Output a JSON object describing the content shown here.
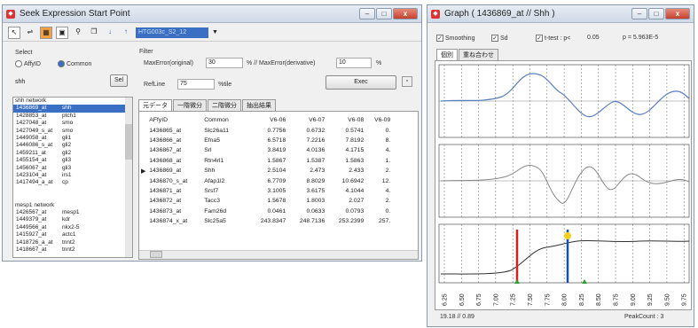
{
  "win1": {
    "title": "Seek Expression Start Point",
    "min": "–",
    "max": "□",
    "close": "x",
    "toolbar_combo": "HTG003c_S2_12"
  },
  "select": {
    "label": "Select",
    "opt_affy": "AffyID",
    "opt_common": "Common",
    "search_value": "shh",
    "sel_button": "Sel"
  },
  "filter": {
    "label": "Filter",
    "maxerror_label": "MaxError(original)",
    "maxerror_value": "30",
    "maxerror_deriv_label": "% // MaxError(derivative)",
    "maxerror_deriv_value": "10",
    "pct": "%",
    "refline_label": "RefLine",
    "refline_value": "75",
    "tile": "%tile",
    "exec": "Exec"
  },
  "list1": {
    "header": "shh network",
    "items": [
      [
        "1436869_at",
        "shh"
      ],
      [
        "1428853_at",
        "ptch1"
      ],
      [
        "1427048_at",
        "smo"
      ],
      [
        "1427049_s_at",
        "smo"
      ],
      [
        "1449058_at",
        "gli1"
      ],
      [
        "1446086_s_at",
        "gli2"
      ],
      [
        "1459211_at",
        "gli2"
      ],
      [
        "1455154_at",
        "gli3"
      ],
      [
        "1456067_at",
        "gli3"
      ],
      [
        "1423104_at",
        "irs1"
      ],
      [
        "1417494_a_at",
        "cp"
      ]
    ]
  },
  "list2": {
    "header": "mesp1 network",
    "items": [
      [
        "1426567_at",
        "mesp1"
      ],
      [
        "1449379_at",
        "kdr"
      ],
      [
        "1449566_at",
        "nkx2-5"
      ],
      [
        "1415927_at",
        "actc1"
      ],
      [
        "1418726_a_at",
        "tnnt2"
      ],
      [
        "1418667_at",
        "tnnt2"
      ]
    ]
  },
  "tabs1": [
    "元データ",
    "一階微分",
    "二階微分",
    "抽出結果"
  ],
  "table": {
    "columns": [
      "AFfyID",
      "Common",
      "V6-06",
      "V6-07",
      "V6-08",
      "V6-09"
    ],
    "rows": [
      [
        "1436865_at",
        "Slc26a11",
        "0.7756",
        "0.6732",
        "0.5741",
        "0."
      ],
      [
        "1436866_at",
        "Efna5",
        "6.5718",
        "7.2216",
        "7.8192",
        "8."
      ],
      [
        "1436867_at",
        "Srl",
        "3.8419",
        "4.0136",
        "4.1715",
        "4."
      ],
      [
        "1436868_at",
        "Rtn4rl1",
        "1.5867",
        "1.5387",
        "1.5863",
        "1."
      ],
      [
        "1436869_at",
        "Shh",
        "2.5104",
        "2.473",
        "2.433",
        "2."
      ],
      [
        "1436870_s_at",
        "Afap1l2",
        "6.7709",
        "8.8029",
        "10.6942",
        "12."
      ],
      [
        "1436871_at",
        "Srsf7",
        "3.1005",
        "3.6175",
        "4.1044",
        "4."
      ],
      [
        "1436872_at",
        "Tacc3",
        "1.5678",
        "1.8003",
        "2.027",
        "2."
      ],
      [
        "1436873_at",
        "Fam26d",
        "0.0461",
        "0.0633",
        "0.0793",
        "0."
      ],
      [
        "1436874_x_at",
        "Slc25a5",
        "243.8347",
        "248.7136",
        "253.2399",
        "257."
      ]
    ]
  },
  "win2": {
    "title": "Graph ( 1436869_at // Shh )",
    "smoothing": "Smoothing",
    "sd": "Sd",
    "ttest": "t-test : p<",
    "ttest_value": "0.05",
    "pvalue": "p = 5.963E-5",
    "tab_individual": "個別",
    "tab_overlay": "重ね合わせ",
    "status_left": "19.18 // 0.89",
    "status_right": "PeakCount : 3"
  },
  "xlabels": [
    "6.25",
    "6.50",
    "6.75",
    "7.00",
    "7.25",
    "7.50",
    "7.75",
    "8.00",
    "8.25",
    "8.50",
    "8.75",
    "9.00",
    "9.25",
    "9.50",
    "9.75"
  ],
  "colors": {
    "accent": "#3a6fc4",
    "red": "#d62020",
    "blue": "#1a4fb5",
    "yellow": "#f2d020",
    "green": "#2fa030"
  }
}
